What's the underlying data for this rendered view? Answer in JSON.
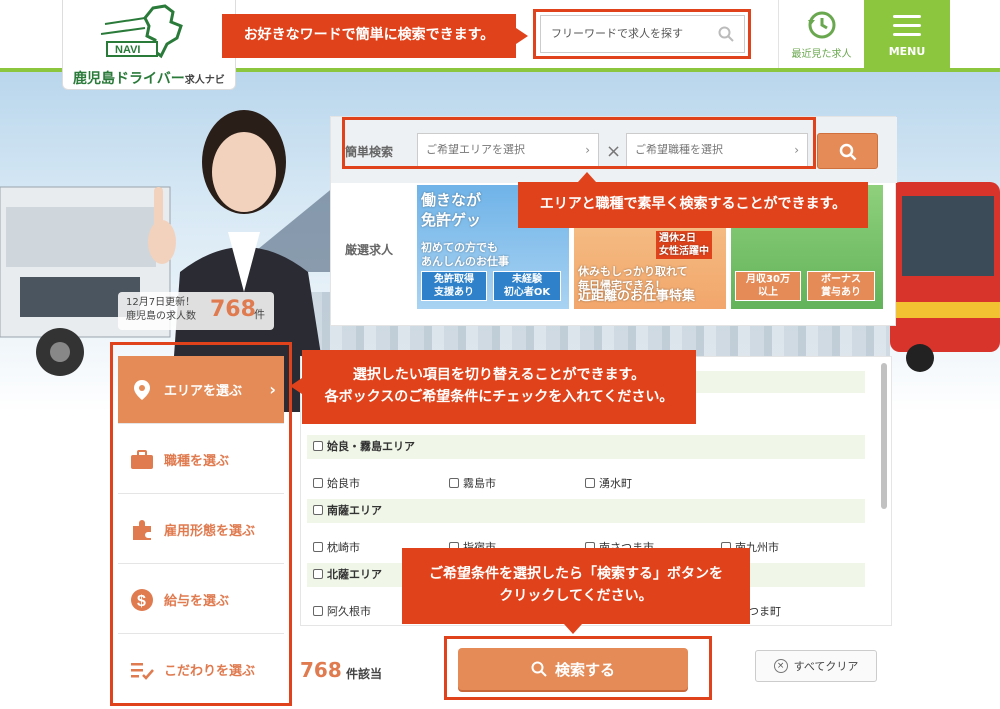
{
  "header": {
    "logo_text": "鹿児島ドライバー",
    "logo_sub": "求人ナビ",
    "logo_badge": "NAVI",
    "search_placeholder": "フリーワードで求人を探す",
    "recent_label": "最近見た求人",
    "menu_label": "MENU",
    "colors": {
      "brand_green": "#8cc63f",
      "accent_orange": "#e58b57",
      "callout_red": "#e0431b"
    }
  },
  "callouts": {
    "freeword": "お好きなワードで簡単に検索できます。",
    "area_job": "エリアと職種で素早く検索することができます。",
    "tabs_line1": "選択したい項目を切り替えることができます。",
    "tabs_line2": "各ボックスのご希望条件にチェックを入れてください。",
    "search_line1": "ご希望条件を選択したら「検索する」ボタンを",
    "search_line2": "クリックしてください。"
  },
  "hero": {
    "updated": "12月7日更新！",
    "count_label": "鹿児島の求人数",
    "count": "768",
    "count_unit": "件"
  },
  "quick_search": {
    "label": "簡単検索",
    "area_placeholder": "ご希望エリアを選択",
    "job_placeholder": "ご希望職種を選択",
    "times": "×"
  },
  "picks": {
    "label": "厳選求人",
    "items": [
      {
        "caption_top1": "働きなが",
        "caption_top2": "免許ゲッ",
        "caption_mid1": "初めての方でも",
        "caption_mid2": "あんしんのお仕事",
        "tags": [
          "免許取得\n支援あり",
          "未経験\n初心者OK"
        ]
      },
      {
        "caption_top1": "週休2日",
        "caption_top2": "女性活躍中",
        "caption_mid1": "休みもしっかり取れて",
        "caption_mid2": "毎日帰宅できる！",
        "caption_bottom": "近距離のお仕事特集"
      },
      {
        "tags": [
          "月収30万\n以上",
          "ボーナス\n賞与あり"
        ]
      }
    ]
  },
  "tabs": [
    {
      "label": "エリアを選ぶ",
      "icon": "map-pin-icon"
    },
    {
      "label": "職種を選ぶ",
      "icon": "briefcase-icon"
    },
    {
      "label": "雇用形態を選ぶ",
      "icon": "puzzle-icon"
    },
    {
      "label": "給与を選ぶ",
      "icon": "dollar-coin-icon"
    },
    {
      "label": "こだわりを選ぶ",
      "icon": "checklist-icon"
    }
  ],
  "area_list": {
    "groups": [
      {
        "name": "姶良・霧島エリア",
        "cities": [
          "姶良市",
          "霧島市",
          "湧水町"
        ]
      },
      {
        "name": "南薩エリア",
        "cities": [
          "枕崎市",
          "指宿市",
          "南さつま市",
          "南九州市"
        ]
      },
      {
        "name": "北薩エリア",
        "cities": [
          "阿久根市",
          "",
          "",
          "さつま町"
        ]
      }
    ]
  },
  "footer": {
    "hit_count": "768",
    "hit_unit": "件該当",
    "search_button": "検索する",
    "clear_button": "すべてクリア"
  }
}
